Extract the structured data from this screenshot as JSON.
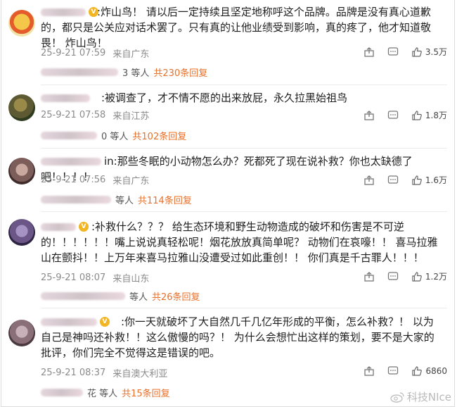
{
  "comments": [
    {
      "text": ":炸山鸟！ 请以后一定持续且坚定地称呼这个品牌。品牌是没有真心道歉的，都只是公关应对话术罢了。只有真的让他业绩受到影响，真的疼了，他才知道敬畏！ 炸山鸟！",
      "time": "25-9-21 07:59",
      "location": "来自广东",
      "likes": "3.5万",
      "reply_prefix": "3 等人",
      "reply_count": "共230条回复"
    },
    {
      "text": ":被调查了，才不情不愿的出来放屁，永久拉黑始祖鸟",
      "time": "25-9-21 07:58",
      "location": "来自江苏",
      "likes": "1.8万",
      "reply_prefix": "0 等人",
      "reply_count": "共102条回复"
    },
    {
      "text": "in:那些冬眠的小动物怎么办？死都死了现在说补救？你也太缺德了吧！！！！",
      "time": "25-9-21 07:56",
      "location": "来自广东",
      "likes": "1.6万",
      "reply_prefix": "等人",
      "reply_count": "共114条回复"
    },
    {
      "text": ":补救什么？？？ 给生态环境和野生动物造成的破坏和伤害是不可逆的！！！！！！嘴上说说真轻松呢！烟花放放真简单呢？ 动物们在哀嚎！！ 喜马拉雅山在颤抖！！上万年来喜马拉雅山没遭受过如此重创！！ 你们真是千古罪人！！！",
      "time": "25-9-21 08:07",
      "location": "来自山东",
      "likes": "1.2万",
      "reply_prefix": "等人",
      "reply_count": "共26条回复"
    },
    {
      "text": ":你一天就破坏了大自然几千几亿年形成的平衡，怎么补救？！ 以为自己是神吗还补救！！这么傲慢的吗？！ 为什么会想忙出这样的策划，要不是大家的批评，你们完全不觉得这是错误的吧。",
      "time": "25-9-21 08:37",
      "location": "来自澳大利亚",
      "likes": "6860",
      "reply_prefix": "花 等人",
      "reply_count": "共15条回复"
    }
  ],
  "watermark": "科技NIce",
  "colors": {
    "reply_accent": "#e8702a",
    "meta_gray": "#8a8a8a"
  },
  "icons": [
    "share-icon",
    "comment-icon",
    "like-icon",
    "vip-badge-icon",
    "weibo-logo-icon"
  ]
}
